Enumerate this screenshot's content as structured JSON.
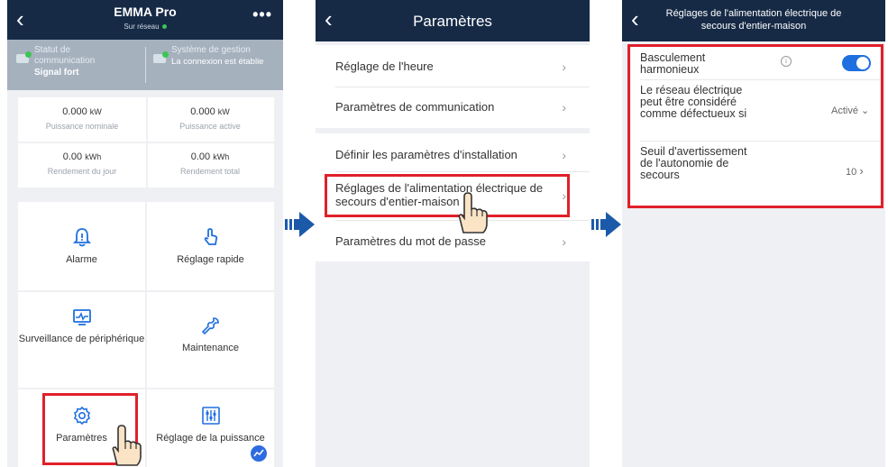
{
  "screen1": {
    "title": "EMMA Pro",
    "subtitle": "Sur réseau",
    "more_label": "•••",
    "status": {
      "comm_label": "Statut de communication",
      "comm_value": "Signal fort",
      "mgmt_label": "Système de gestion",
      "mgmt_value": "La connexion est établie"
    },
    "kpis": [
      {
        "value": "0.000",
        "unit": "kW",
        "label": "Puissance nominale"
      },
      {
        "value": "0.000",
        "unit": "kW",
        "label": "Puissance active"
      },
      {
        "value": "0.00",
        "unit": "kWh",
        "label": "Rendement du jour"
      },
      {
        "value": "0.00",
        "unit": "kWh",
        "label": "Rendement total"
      }
    ],
    "tiles": [
      {
        "label": "Alarme",
        "icon": "bell-icon"
      },
      {
        "label": "Réglage rapide",
        "icon": "touch-icon"
      },
      {
        "label": "Surveillance de périphérique",
        "icon": "monitor-icon"
      },
      {
        "label": "Maintenance",
        "icon": "wrench-icon"
      },
      {
        "label": "Paramètres",
        "icon": "gear-icon"
      },
      {
        "label": "Réglage de la puissance",
        "icon": "sliders-icon"
      }
    ]
  },
  "screen2": {
    "title": "Paramètres",
    "items": [
      {
        "label": "Réglage de l'heure"
      },
      {
        "label": "Paramètres de communication"
      },
      {
        "label": "Définir les paramètres d'installation"
      },
      {
        "label": "Réglages de l'alimentation électrique de secours d'entier-maison"
      },
      {
        "label": "Paramètres du mot de passe"
      }
    ]
  },
  "screen3": {
    "title": "Réglages de l'alimentation électrique de secours d'entier-maison",
    "rows": [
      {
        "label": "Basculement harmonieux",
        "toggle_on": true
      },
      {
        "label": "Le réseau électrique peut être considéré comme défectueux si",
        "value": "Activé"
      },
      {
        "label": "Seuil d'avertissement de l'autonomie de secours",
        "value": "10"
      }
    ]
  },
  "colors": {
    "navbar": "#162a46",
    "highlight": "#e0202a",
    "accent_blue": "#1f6fe0",
    "arrow_blue": "#1b5aa8"
  }
}
